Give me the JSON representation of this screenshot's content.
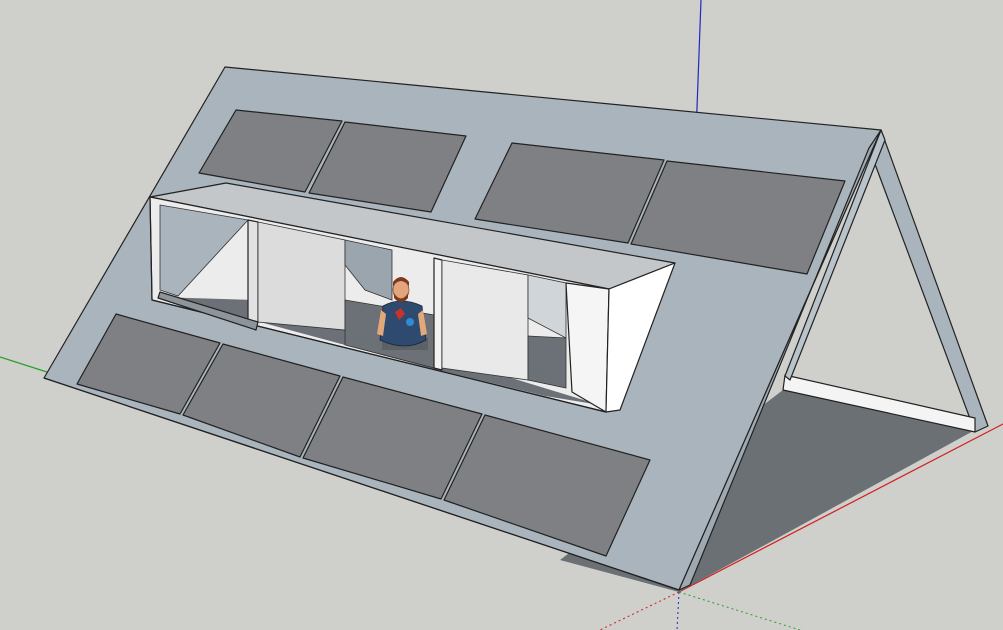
{
  "viewport": {
    "title": "",
    "colors": {
      "background": "#cfcfcb",
      "roof": "#a9b4bc",
      "roof_shadow": "#9ea9b1",
      "solar_panel": "#7f8083",
      "solar_panel_dark": "#6f7073",
      "ground_shadow": "#6b7075",
      "interior_wall": "#ececec",
      "interior_floor": "#6c7177",
      "axis_blue": "#1f2bbd",
      "axis_red": "#d21e1e",
      "axis_green": "#27a027"
    },
    "model": {
      "solar_panel_count": 8,
      "figure": "person-figure"
    },
    "icons": {
      "person": "person-figure-icon",
      "axes": "axes-origin-icon"
    }
  }
}
